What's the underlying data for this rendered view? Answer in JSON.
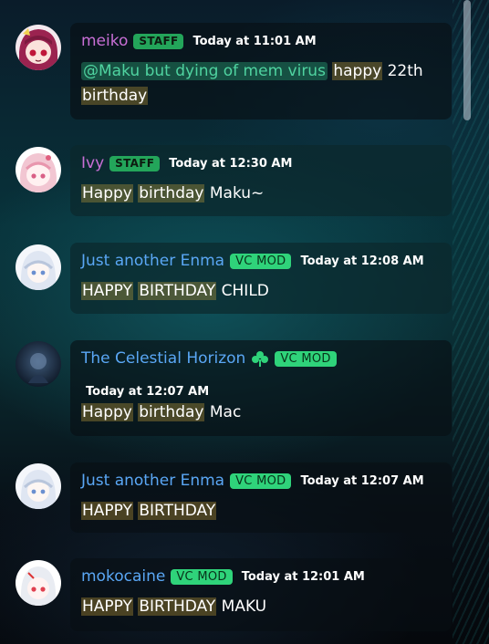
{
  "colors": {
    "staff_name": "#c96fd6",
    "mod_name": "#5aa7f5",
    "badge_bg": "#23a55a",
    "highlight": "#6b5a2a"
  },
  "messages": [
    {
      "author": "meiko",
      "badge": "STAFF",
      "time": "Today at 11:01 AM",
      "mention": "@Maku but dying of mem virus",
      "h1": "happy",
      "t1": "22th",
      "h2": "birthday"
    },
    {
      "author": "Ivy",
      "badge": "STAFF",
      "time": "Today at 12:30 AM",
      "h1": "Happy",
      "h2": "birthday",
      "t1": "Maku~"
    },
    {
      "author": "Just another Enma",
      "badge": "VC MOD",
      "time": "Today at 12:08 AM",
      "h1": "HAPPY",
      "h2": "BIRTHDAY",
      "t1": "CHILD"
    },
    {
      "author": "The Celestial Horizon",
      "decoration_icon": "clover-icon",
      "badge": "VC MOD",
      "time": "Today at 12:07 AM",
      "h1": "Happy",
      "h2": "birthday",
      "t1": "Mac"
    },
    {
      "author": "Just another Enma",
      "badge": "VC MOD",
      "time": "Today at 12:07 AM",
      "h1": "HAPPY",
      "h2": "BIRTHDAY"
    },
    {
      "author": "mokocaine",
      "badge": "VC MOD",
      "time": "Today at 12:01 AM",
      "h1": "HAPPY",
      "h2": "BIRTHDAY",
      "t1": "MAKU"
    }
  ]
}
